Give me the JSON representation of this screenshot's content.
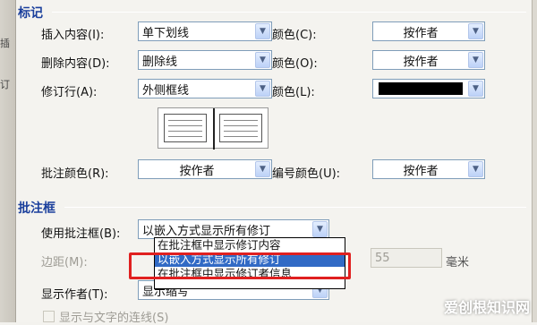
{
  "sections": {
    "markup_title": "标记",
    "balloon_title": "批注框"
  },
  "markup": {
    "insertions_label": "插入内容(I):",
    "insertions_value": "单下划线",
    "insertions_color_label": "颜色(C):",
    "insertions_color_value": "按作者",
    "deletions_label": "删除内容(D):",
    "deletions_value": "删除线",
    "deletions_color_label": "颜色(O):",
    "deletions_color_value": "按作者",
    "changed_lines_label": "修订行(A):",
    "changed_lines_value": "外侧框线",
    "changed_lines_color_label": "颜色(L):",
    "changed_lines_color_value": "#000000",
    "comments_color_label": "批注颜色(R):",
    "comments_color_value": "按作者",
    "numbering_color_label": "编号颜色(U):",
    "numbering_color_value": "按作者"
  },
  "balloons": {
    "use_balloons_label": "使用批注框(B):",
    "use_balloons_value": "以嵌入方式显示所有修订",
    "options": [
      "在批注框中显示修订内容",
      "以嵌入方式显示所有修订",
      "在批注框中显示修订者信息"
    ],
    "selected_index": 1,
    "margin_label": "边距(M):",
    "width_value": "55",
    "width_unit": "毫米",
    "show_author_label": "显示作者(T):",
    "show_author_value": "显示缩写",
    "show_lines_label": "显示与文字的连线(S)"
  },
  "left_fragments": [
    "插",
    "订"
  ],
  "watermark": "爱创根知识网",
  "colors": {
    "accent": "#1a3f9c",
    "selection": "#316ac5",
    "highlight": "#e02020"
  }
}
